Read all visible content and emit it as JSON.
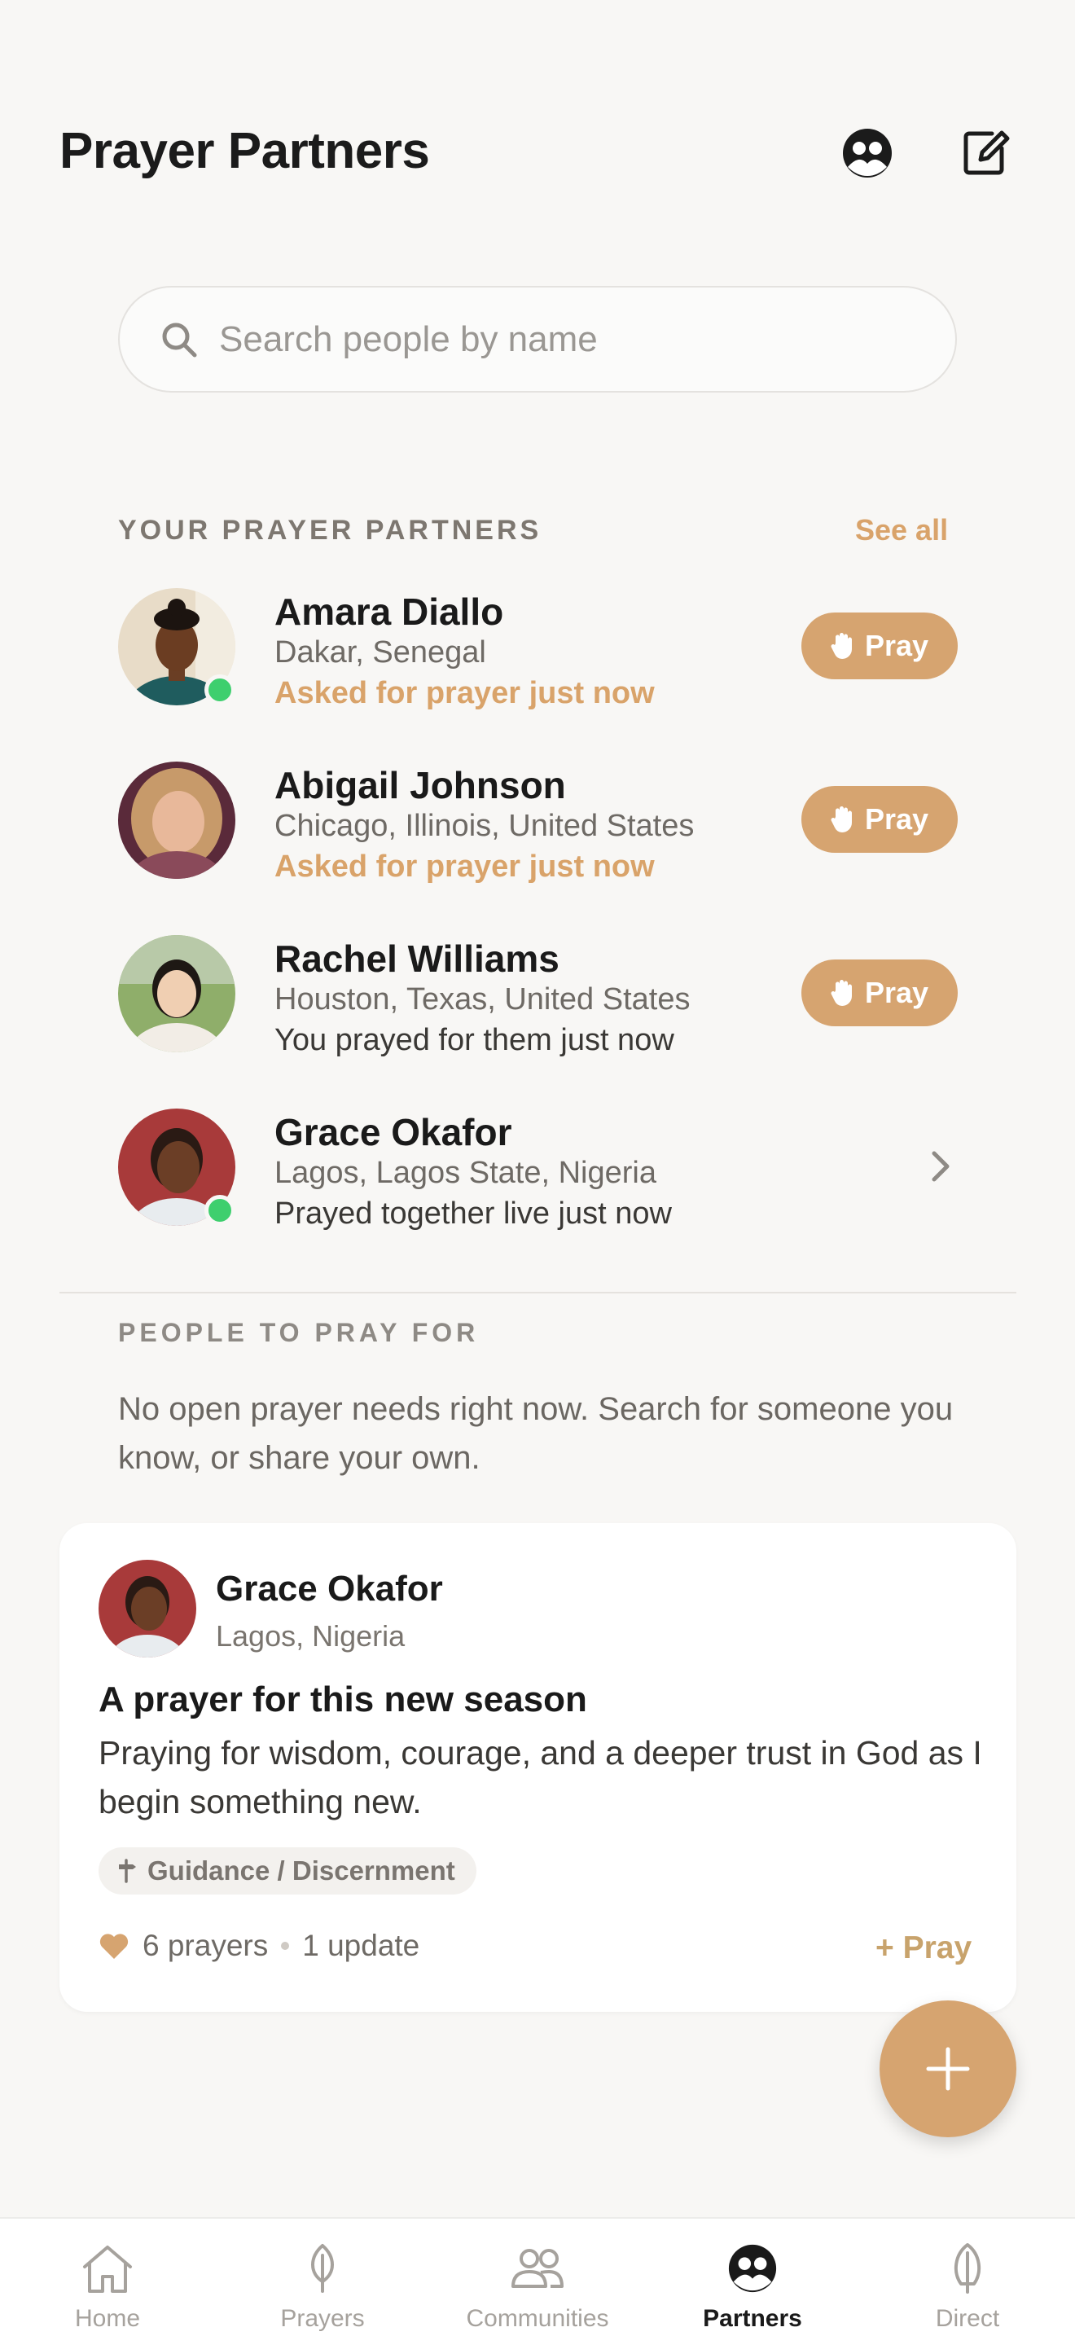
{
  "header": {
    "title": "Prayer Partners"
  },
  "search": {
    "placeholder": "Search people by name"
  },
  "partners_section": {
    "label": "YOUR PRAYER PARTNERS",
    "see_all": "See all",
    "partners": [
      {
        "name": "Amara Diallo",
        "location": "Dakar, Senegal",
        "status": "Asked for prayer just now",
        "action": "Pray",
        "online": true
      },
      {
        "name": "Abigail Johnson",
        "location": "Chicago, Illinois, United States",
        "status": "Asked for prayer just now",
        "action": "Pray",
        "online": false
      },
      {
        "name": "Rachel Williams",
        "location": "Houston, Texas, United States",
        "status": "You prayed for them just now",
        "action": "Pray",
        "online": false
      },
      {
        "name": "Grace Okafor",
        "location": "Lagos, Lagos State, Nigeria",
        "status": "Prayed together live just now",
        "action": "",
        "online": true
      }
    ]
  },
  "people_section": {
    "label": "PEOPLE TO PRAY FOR",
    "empty_message": "No open prayer needs right now. Search for someone you know, or share your own."
  },
  "card": {
    "author": "Grace Okafor",
    "location": "Lagos, Nigeria",
    "title": "A prayer for this new season",
    "body": "Praying for wisdom, courage, and a deeper trust in God as I begin something new.",
    "tag": "Guidance / Discernment",
    "prayers": "6 prayers",
    "updates": "1 update",
    "action": "+ Pray"
  },
  "tabs": [
    {
      "label": "Home",
      "icon": "home-icon"
    },
    {
      "label": "Prayers",
      "icon": "leaf-icon"
    },
    {
      "label": "Communities",
      "icon": "people-icon"
    },
    {
      "label": "Partners",
      "icon": "partners-icon",
      "active": true
    },
    {
      "label": "Direct",
      "icon": "feather-icon"
    }
  ],
  "colors": {
    "accent": "#d6a470",
    "accent_text": "#d9a36a",
    "online": "#3ecf6e",
    "background": "#f8f7f5"
  }
}
